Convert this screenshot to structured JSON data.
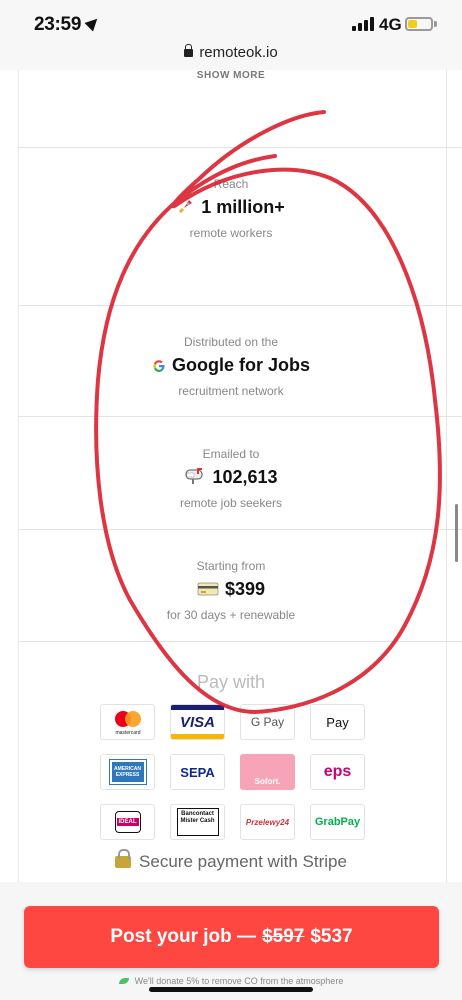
{
  "status_bar": {
    "time": "23:59",
    "network": "4G",
    "battery_level": 0.4
  },
  "browser": {
    "url": "remoteok.io"
  },
  "show_more": "SHOW MORE",
  "stats": [
    {
      "label": "Reach",
      "value": "1 million+",
      "sub": "remote workers",
      "icon": "rocket-icon"
    },
    {
      "label": "Distributed on the",
      "value": "Google for Jobs",
      "sub": "recruitment network",
      "icon": "google-icon"
    },
    {
      "label": "Emailed to",
      "value": "102,613",
      "sub": "remote job seekers",
      "icon": "mailbox-icon"
    },
    {
      "label": "Starting from",
      "value": "$399",
      "sub": "for 30 days + renewable",
      "icon": "credit-card-icon"
    }
  ],
  "pay": {
    "title": "Pay with",
    "methods": [
      {
        "name": "mastercard",
        "label": "mastercard"
      },
      {
        "name": "visa",
        "label": "VISA"
      },
      {
        "name": "google-pay",
        "label": "G Pay"
      },
      {
        "name": "apple-pay",
        "label": " Pay"
      },
      {
        "name": "american-express",
        "label": "AMERICAN EXPRESS"
      },
      {
        "name": "sepa",
        "label": "SEPA"
      },
      {
        "name": "sofort",
        "label": "Sofort."
      },
      {
        "name": "eps",
        "label": "eps"
      },
      {
        "name": "ideal",
        "label": "iDEAL"
      },
      {
        "name": "bancontact",
        "label": "Bancontact Mister Cash"
      },
      {
        "name": "przelewy24",
        "label": "Przelewy24"
      },
      {
        "name": "grabpay",
        "label": "GrabPay"
      }
    ],
    "secure": "Secure payment with Stripe"
  },
  "cta": {
    "label": "Post your job —",
    "old_price": "$597",
    "new_price": "$537"
  },
  "donate": "We'll donate 5% to remove CO  from the atmosphere",
  "colors": {
    "accent": "#ff4742",
    "scribble": "#d9202d"
  }
}
